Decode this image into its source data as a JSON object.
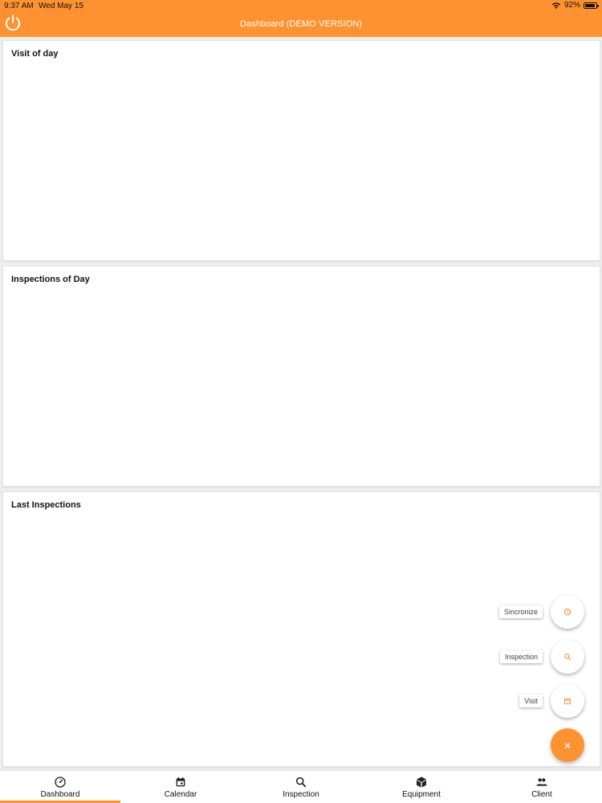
{
  "status_bar": {
    "time": "9:37 AM",
    "date": "Wed May 15",
    "battery": "92%",
    "battery_level": 0.92
  },
  "header": {
    "title": "Dashboard (DEMO VERSION)",
    "power_icon": "power-icon"
  },
  "cards": {
    "visit_of_day": "Visit of day",
    "inspections_of_day": "Inspections of Day",
    "last_inspections": "Last Inspections"
  },
  "fab_menu": {
    "sincronize": "Sincronize",
    "inspection": "Inspection",
    "visit": "Visit",
    "close": "×"
  },
  "bottom_nav": {
    "dashboard": "Dashboard",
    "calendar": "Calendar",
    "inspection": "Inspection",
    "equipment": "Equipment",
    "client": "Client"
  },
  "colors": {
    "accent": "#ff9230",
    "background": "#eeeeee",
    "card": "#ffffff"
  }
}
